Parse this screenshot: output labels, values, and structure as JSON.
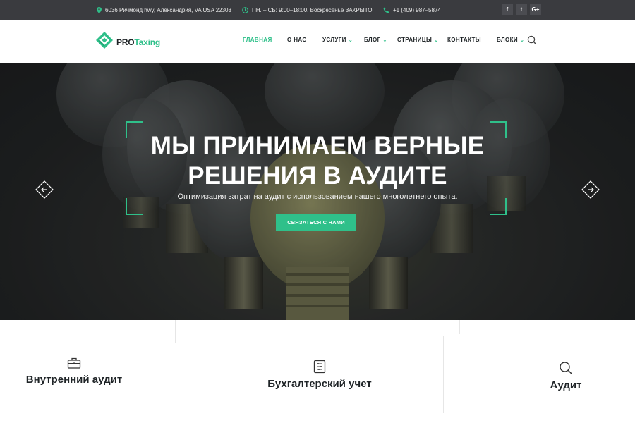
{
  "topbar": {
    "address": "6036 Ричмонд hwy, Александрия, VA USA 22303",
    "hours": "ПН. – СБ: 9:00–18:00. Воскресенье ЗАКРЫТО",
    "phone": "+1 (409) 987–5874",
    "social": [
      "f",
      "t",
      "G+"
    ],
    "icons": [
      "map-pin-icon",
      "clock-icon",
      "phone-icon"
    ]
  },
  "header": {
    "logo_pro": "PRO",
    "logo_taxing": "Taxing",
    "nav": {
      "home": "ГЛАВНАЯ",
      "about": "О НАС",
      "services": "УСЛУГИ",
      "blog": "БЛОГ",
      "pages": "СТРАНИЦЫ",
      "contacts": "КОНТАКТЫ",
      "blocks": "БЛОКИ"
    }
  },
  "hero": {
    "title_line1": "МЫ ПРИНИМАЕМ ВЕРНЫЕ",
    "title_line2": "РЕШЕНИЯ В АУДИТЕ",
    "subtitle": "Оптимизация затрат на аудит с использованием нашего многолетнего опыта.",
    "button": "Связаться с нами"
  },
  "services": [
    {
      "title": "Внутренний аудит",
      "icon": "briefcase-icon"
    },
    {
      "title": "Бухгалтерский учет",
      "icon": "ledger-icon"
    },
    {
      "title": "Аудит",
      "icon": "search-icon"
    }
  ],
  "colors": {
    "accent": "#2fc08a",
    "topbar_bg": "#3a3b3f",
    "text_dark": "#1f2427"
  }
}
